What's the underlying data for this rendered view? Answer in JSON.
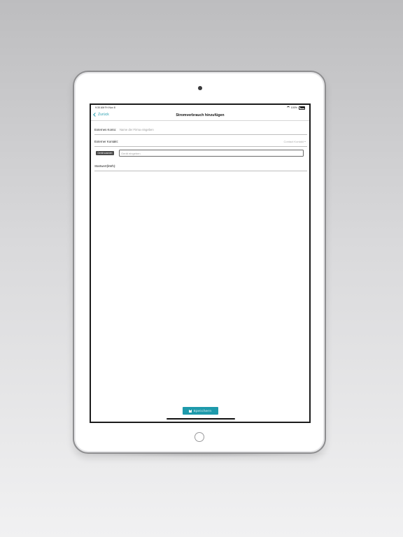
{
  "status_bar": {
    "time_date": "9:30 AM  Fri Nov 8",
    "battery": "100%"
  },
  "nav": {
    "back_label": "Zurück",
    "title": "Stromverbrauch hinzufügen"
  },
  "form": {
    "external_account_label": "Externes Konto:",
    "external_account_placeholder": "Name der Firma eingeben",
    "external_contact_label": "Externer Kontakt:",
    "external_contact_value": "Contact Kontakt",
    "scan_button_label": "Gerät scannen",
    "device_placeholder": "Gerät eingeben",
    "meter_label": "Startwert(kWh):"
  },
  "actions": {
    "save_label": "Speichern"
  },
  "colors": {
    "accent": "#1e9aab",
    "link": "#2a9fb0"
  }
}
